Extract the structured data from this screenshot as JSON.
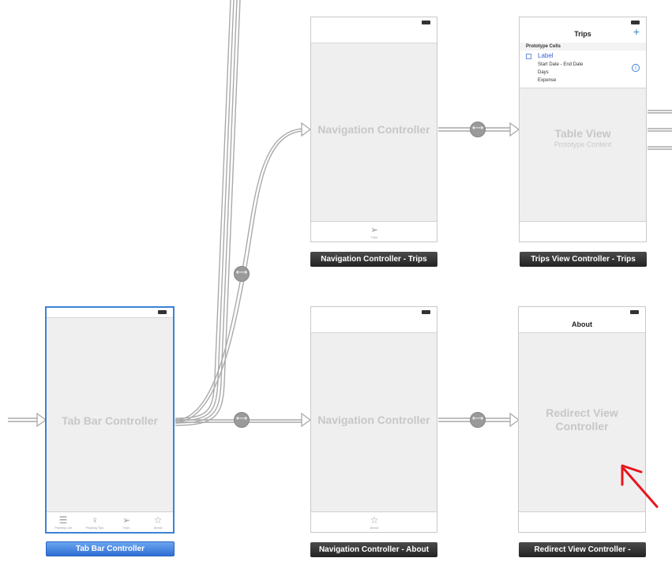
{
  "scenes": {
    "tab_bar": {
      "title": "Tab Bar Controller",
      "label": "Tab Bar Controller",
      "tabs": [
        {
          "icon": "list-icon",
          "glyph": "☰",
          "label": "Packing List"
        },
        {
          "icon": "lightbulb-icon",
          "glyph": "♀",
          "label": "Packing Tips"
        },
        {
          "icon": "paper-plane-icon",
          "glyph": "➢",
          "label": "Trips"
        },
        {
          "icon": "star-icon",
          "glyph": "☆",
          "label": "About"
        }
      ]
    },
    "nav_trips": {
      "title": "Navigation Controller",
      "label": "Navigation Controller - Trips",
      "tab_glyph": "➢",
      "tab_label": "Trips"
    },
    "trips_vc": {
      "nav_title": "Trips",
      "add_glyph": "+",
      "prototype_header": "Prototype Cells",
      "cell_label": "Label",
      "cell_lines": [
        "Start Date - End Date",
        "Days",
        "Expense"
      ],
      "info_glyph": "i",
      "table_title": "Table View",
      "table_subtitle": "Prototype Content",
      "label": "Trips View Controller - Trips"
    },
    "nav_about": {
      "title": "Navigation Controller",
      "label": "Navigation Controller - About",
      "tab_glyph": "☆",
      "tab_label": "About"
    },
    "redirect_vc": {
      "nav_title": "About",
      "title": "Redirect View Controller",
      "label": "Redirect View Controller -"
    }
  },
  "colors": {
    "selection": "#3b82d6",
    "segue_line": "#a9a9a9",
    "annotation_arrow": "#e8141b"
  }
}
